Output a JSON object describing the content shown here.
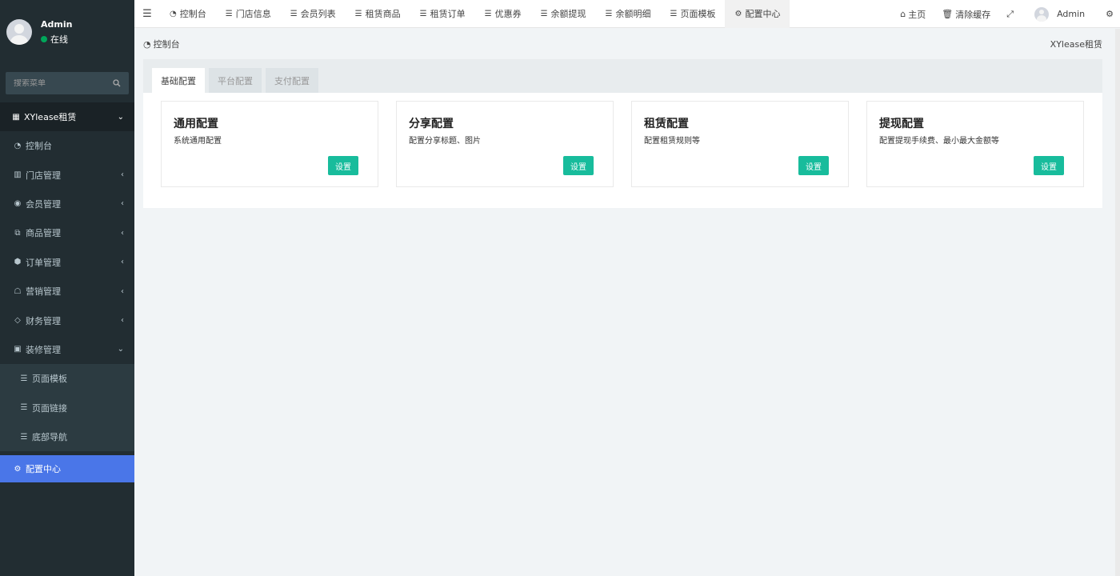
{
  "sidebar": {
    "user": {
      "name": "Admin",
      "status": "在线"
    },
    "search": {
      "placeholder": "搜索菜单"
    },
    "group_head": {
      "label": "XYlease租赁"
    },
    "items": [
      {
        "label": "控制台",
        "icon": "dashboard-icon"
      },
      {
        "label": "门店管理",
        "icon": "store-icon"
      },
      {
        "label": "会员管理",
        "icon": "user-icon"
      },
      {
        "label": "商品管理",
        "icon": "goods-icon"
      },
      {
        "label": "订单管理",
        "icon": "order-icon"
      },
      {
        "label": "营销管理",
        "icon": "marketing-icon"
      },
      {
        "label": "财务管理",
        "icon": "finance-icon"
      },
      {
        "label": "装修管理",
        "icon": "decorate-icon"
      }
    ],
    "sub_items": [
      {
        "label": "页面模板"
      },
      {
        "label": "页面链接"
      },
      {
        "label": "底部导航"
      }
    ],
    "active_item": {
      "label": "配置中心",
      "icon": "gear-icon"
    }
  },
  "topbar": {
    "tabs": [
      {
        "label": "控制台"
      },
      {
        "label": "门店信息"
      },
      {
        "label": "会员列表"
      },
      {
        "label": "租赁商品"
      },
      {
        "label": "租赁订单"
      },
      {
        "label": "优惠券"
      },
      {
        "label": "余额提现"
      },
      {
        "label": "余额明细"
      },
      {
        "label": "页面模板"
      },
      {
        "label": "配置中心"
      }
    ],
    "right": {
      "home": "主页",
      "clear_cache": "清除缓存",
      "user": "Admin"
    }
  },
  "breadcrumb": {
    "current": "控制台",
    "right": "XYlease租赁"
  },
  "panel": {
    "tabs": [
      {
        "label": "基础配置"
      },
      {
        "label": "平台配置"
      },
      {
        "label": "支付配置"
      }
    ],
    "cards": [
      {
        "title": "通用配置",
        "desc": "系统通用配置",
        "button": "设置"
      },
      {
        "title": "分享配置",
        "desc": "配置分享标题、图片",
        "button": "设置"
      },
      {
        "title": "租赁配置",
        "desc": "配置租赁规则等",
        "button": "设置"
      },
      {
        "title": "提现配置",
        "desc": "配置提现手续费、最小最大金额等",
        "button": "设置"
      }
    ]
  },
  "colors": {
    "accent": "#4a76e8",
    "button": "#18bc9c",
    "sidebar_bg": "#222d32"
  }
}
